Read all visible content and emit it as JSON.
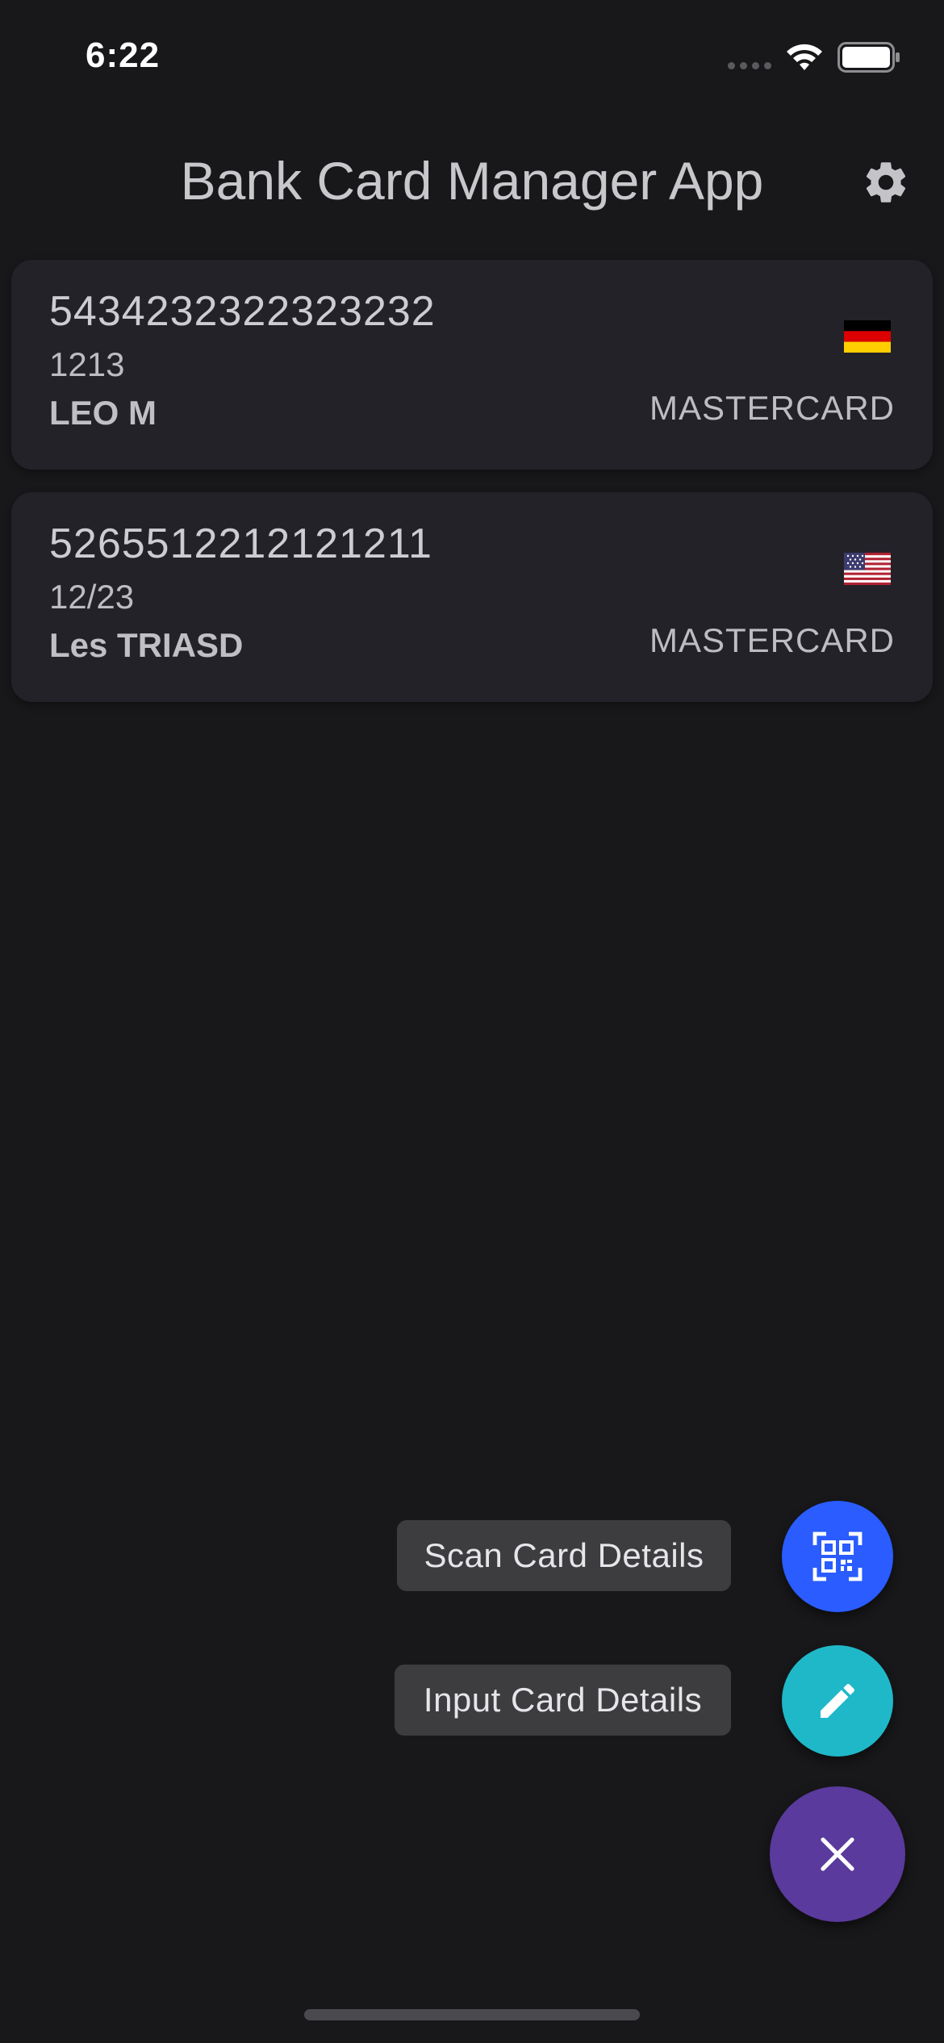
{
  "status_bar": {
    "time": "6:22",
    "icons": [
      "cellular-signal-icon",
      "wifi-icon",
      "battery-icon"
    ]
  },
  "header": {
    "title": "Bank Card Manager App",
    "settings_icon": "gear-icon"
  },
  "cards": [
    {
      "number": "5434232322323232",
      "expiry": "1213",
      "holder": "LEO M",
      "brand": "MASTERCARD",
      "flag": "germany-flag-icon"
    },
    {
      "number": "5265512212121211",
      "expiry": "12/23",
      "holder": "Les TRIASD",
      "brand": "MASTERCARD",
      "flag": "usa-flag-icon"
    }
  ],
  "fab_menu": {
    "scan_label": "Scan Card Details",
    "input_label": "Input Card Details",
    "scan_icon": "qr-scan-icon",
    "input_icon": "pencil-icon",
    "close_icon": "close-icon"
  },
  "colors": {
    "background": "#18181a",
    "card_background": "#232228",
    "scan_button": "#2a5cff",
    "input_button": "#1fb8c9",
    "close_button": "#5a3a9c"
  }
}
